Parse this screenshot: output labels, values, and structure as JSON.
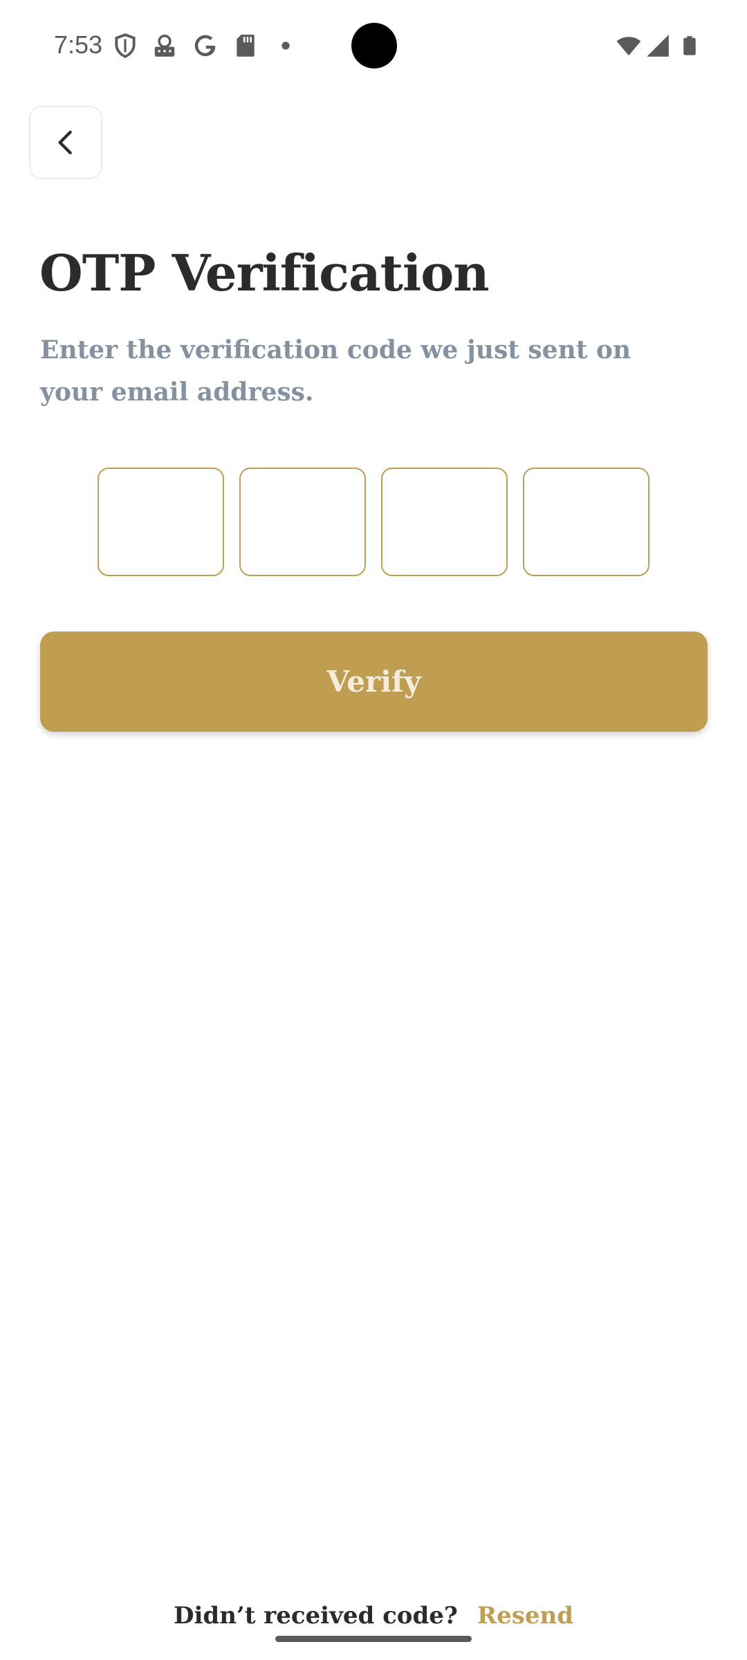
{
  "status_bar": {
    "time": "7:53",
    "icons": [
      "shield-icon",
      "keyboard-icon",
      "google-icon",
      "sd-card-icon",
      "dot-icon",
      "wifi-icon",
      "signal-icon",
      "battery-icon"
    ]
  },
  "header": {
    "back_icon": "chevron-left-icon"
  },
  "main": {
    "title": "OTP Verification",
    "subtitle": "Enter the verification code we just sent on your email address.",
    "otp": {
      "digits": [
        "",
        "",
        "",
        ""
      ]
    },
    "verify_label": "Verify"
  },
  "footer": {
    "question": "Didn’t received code?",
    "resend_label": "Resend"
  },
  "colors": {
    "accent": "#bf9e51",
    "title": "#2b2b2b",
    "subtitle": "#8391a1",
    "background": "#ffffff"
  }
}
